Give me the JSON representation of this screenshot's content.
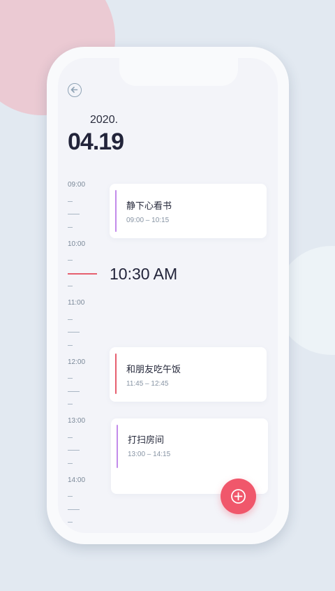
{
  "header": {
    "year": "2020.",
    "date": "04.19"
  },
  "timeline": {
    "hours": [
      "09:00",
      "10:00",
      "11:00",
      "12:00",
      "13:00",
      "14:00"
    ],
    "current_time": "10:30 AM"
  },
  "events": [
    {
      "title": "静下心看书",
      "time": "09:00 – 10:15",
      "color": "#c38bea"
    },
    {
      "title": "和朋友吃午饭",
      "time": "11:45 – 12:45",
      "color": "#e65f6f"
    },
    {
      "title": "打扫房间",
      "time": "13:00 – 14:15",
      "color": "#c38bea"
    }
  ],
  "icons": {
    "back": "arrow-left-circle-icon",
    "add": "plus-circle-icon"
  },
  "colors": {
    "accent": "#f0576b",
    "current_line": "#e65f6f",
    "event_purple": "#c38bea"
  }
}
